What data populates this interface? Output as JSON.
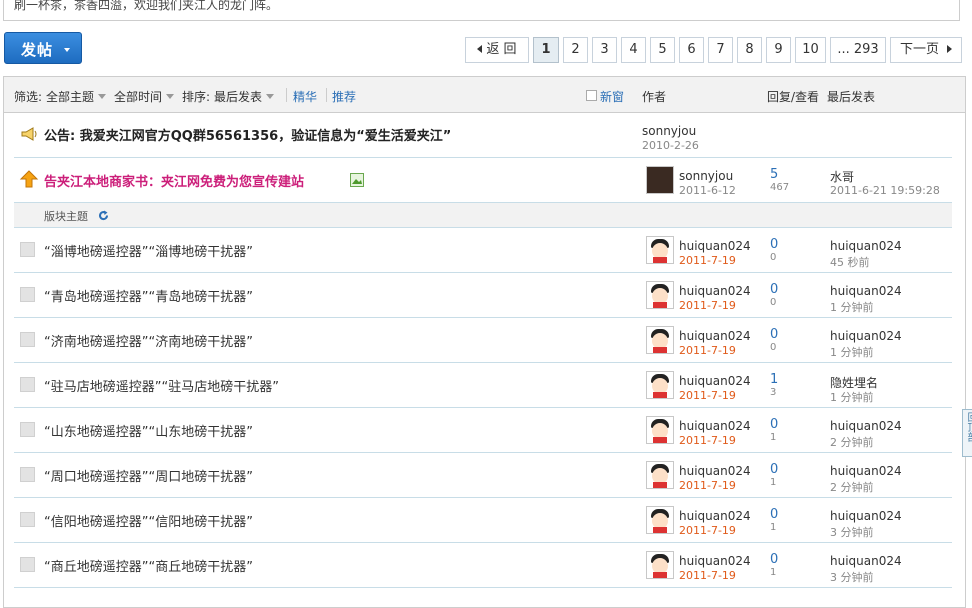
{
  "top_notice": "刷一杯茶，茶香四溢，欢迎我们夹江人的龙门阵。",
  "post_button": "发帖",
  "pager": {
    "back": "返 回",
    "pages": [
      "1",
      "2",
      "3",
      "4",
      "5",
      "6",
      "7",
      "8",
      "9",
      "10",
      "... 293"
    ],
    "current": "1",
    "next": "下一页"
  },
  "header": {
    "filter_label": "筛选:",
    "all_topics": "全部主题",
    "all_time": "全部时间",
    "sort_label": "排序:",
    "sort_value": "最后发表",
    "digest": "精华",
    "recommend": "推荐",
    "new_window": "新窗",
    "author": "作者",
    "replies_views": "回复/查看",
    "last_post": "最后发表"
  },
  "announcement": {
    "title": "公告: 我爱夹江网官方QQ群56561356，验证信息为“爱生活爱夹江”",
    "author": "sonnyjou",
    "date": "2010-2-26"
  },
  "sticky": {
    "title": "告夹江本地商家书：夹江网免费为您宣传建站",
    "author": "sonnyjou",
    "date": "2011-6-12",
    "replies": "5",
    "views": "467",
    "last_user": "水哥",
    "last_time": "2011-6-21 19:59:28"
  },
  "section_label": "版块主题",
  "threads": [
    {
      "title": "“淄博地磅遥控器”“淄博地磅干扰器”",
      "author": "huiquan024",
      "date": "2011-7-19",
      "replies": "0",
      "views": "0",
      "last_user": "huiquan024",
      "last_time": "45 秒前"
    },
    {
      "title": "“青岛地磅遥控器”“青岛地磅干扰器”",
      "author": "huiquan024",
      "date": "2011-7-19",
      "replies": "0",
      "views": "0",
      "last_user": "huiquan024",
      "last_time": "1 分钟前"
    },
    {
      "title": "“济南地磅遥控器”“济南地磅干扰器”",
      "author": "huiquan024",
      "date": "2011-7-19",
      "replies": "0",
      "views": "0",
      "last_user": "huiquan024",
      "last_time": "1 分钟前"
    },
    {
      "title": "“驻马店地磅遥控器”“驻马店地磅干扰器”",
      "author": "huiquan024",
      "date": "2011-7-19",
      "replies": "1",
      "views": "3",
      "last_user": "隐姓埋名",
      "last_time": "1 分钟前"
    },
    {
      "title": "“山东地磅遥控器”“山东地磅干扰器”",
      "author": "huiquan024",
      "date": "2011-7-19",
      "replies": "0",
      "views": "1",
      "last_user": "huiquan024",
      "last_time": "2 分钟前"
    },
    {
      "title": "“周口地磅遥控器”“周口地磅干扰器”",
      "author": "huiquan024",
      "date": "2011-7-19",
      "replies": "0",
      "views": "1",
      "last_user": "huiquan024",
      "last_time": "2 分钟前"
    },
    {
      "title": "“信阳地磅遥控器”“信阳地磅干扰器”",
      "author": "huiquan024",
      "date": "2011-7-19",
      "replies": "0",
      "views": "1",
      "last_user": "huiquan024",
      "last_time": "3 分钟前"
    },
    {
      "title": "“商丘地磅遥控器”“商丘地磅干扰器”",
      "author": "huiquan024",
      "date": "2011-7-19",
      "replies": "0",
      "views": "1",
      "last_user": "huiquan024",
      "last_time": "3 分钟前"
    }
  ],
  "side_tab": "回顶部"
}
